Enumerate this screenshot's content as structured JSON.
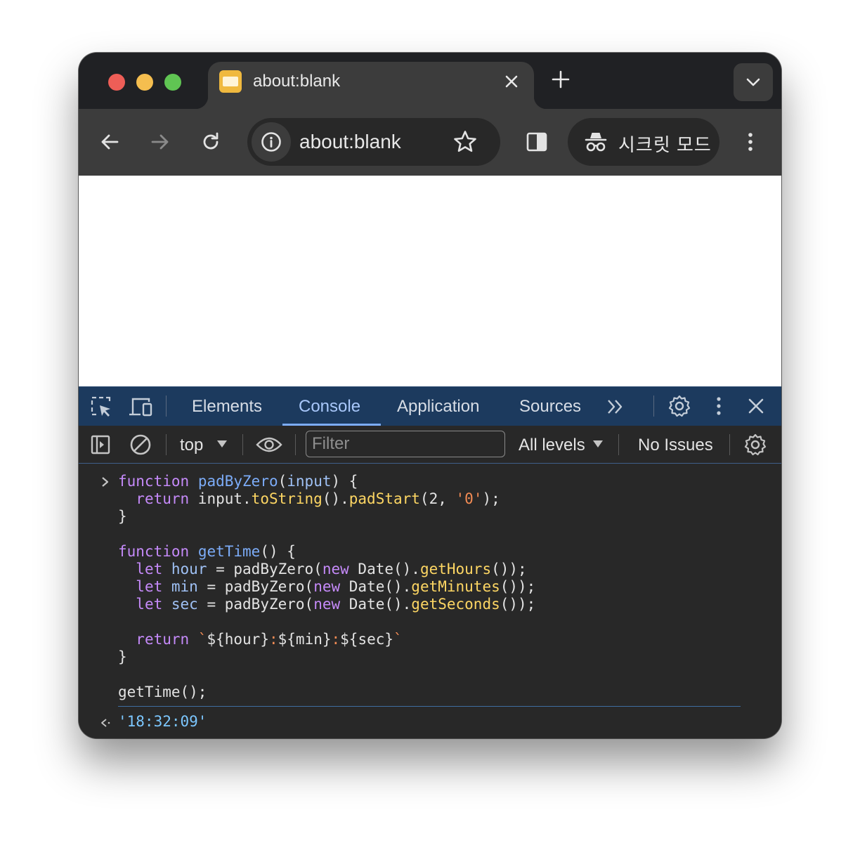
{
  "browser": {
    "tab": {
      "title": "about:blank"
    },
    "address": {
      "url": "about:blank"
    },
    "incognito_label": "시크릿 모드"
  },
  "devtools": {
    "tabs": [
      "Elements",
      "Console",
      "Application",
      "Sources"
    ],
    "active_tab": "Console",
    "context": "top",
    "filter_placeholder": "Filter",
    "levels": "All levels",
    "issues": "No Issues"
  },
  "console": {
    "input_lines": [
      "function padByZero(input) {",
      "  return input.toString().padStart(2, '0');",
      "}",
      "",
      "function getTime() {",
      "  let hour = padByZero(new Date().getHours());",
      "  let min = padByZero(new Date().getMinutes());",
      "  let sec = padByZero(new Date().getSeconds());",
      "",
      "  return `${hour}:${min}:${sec}`",
      "}",
      "",
      "getTime();"
    ],
    "output": "'18:32:09'"
  },
  "colors": {
    "devtools_tabbar": "#1c3a5e",
    "active_tab": "#a8c7fa",
    "keyword": "#c58af9",
    "function_name": "#7cacf8",
    "method": "#fdd663",
    "string": "#f28b54",
    "output": "#7cc7ff"
  }
}
